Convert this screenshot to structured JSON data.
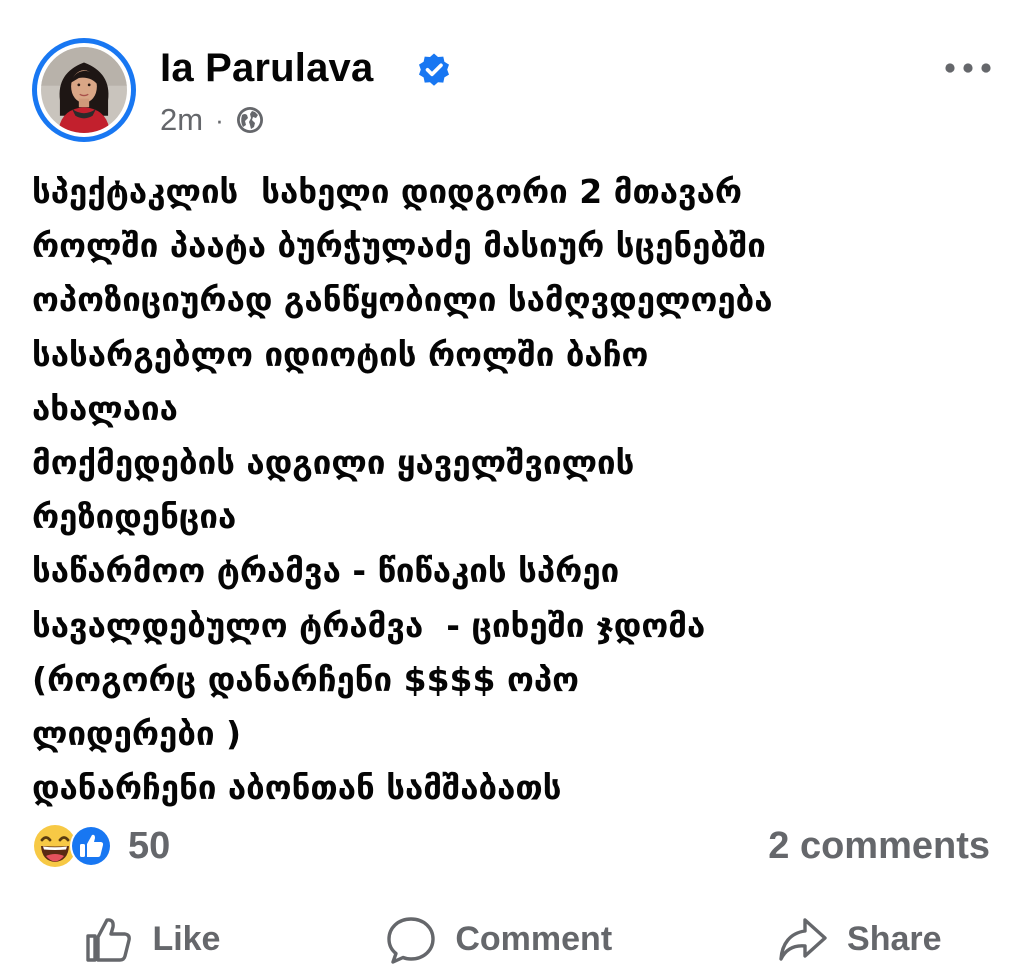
{
  "post": {
    "author": "Ia Parulava",
    "time": "2m",
    "separator": "·",
    "audience_icon": "globe-icon",
    "verified_icon": "verified-badge-icon",
    "text": "სპექტაკლის  სახელი დიდგორი 2 მთავარ\nროლში პაატა ბურჭულაძე მასიურ სცენებში\nოპოზიციურად განწყობილი სამღვდელოება\nსასარგებლო იდიოტის როლში ბაჩო\nახალაია\nმოქმედების ადგილი ყაველშვილის\nრეზიდენცია\nსაწარმოო ტრამვა - წიწაკის სპრეი\nსავალდებულო ტრამვა  - ციხეში ჯდომა\n(როგორც დანარჩენი $$$$ ოპო\nლიდერები )\nდანარჩენი აბონთან სამშაბათს"
  },
  "stats": {
    "reaction_count": "50",
    "comments": "2 comments",
    "reaction_icons": [
      "laughing-emoji-icon",
      "like-reaction-icon"
    ]
  },
  "actions": {
    "like": "Like",
    "comment": "Comment",
    "share": "Share"
  },
  "colors": {
    "accent": "#1877f2",
    "secondary_text": "#65676b",
    "primary_text": "#050505"
  }
}
